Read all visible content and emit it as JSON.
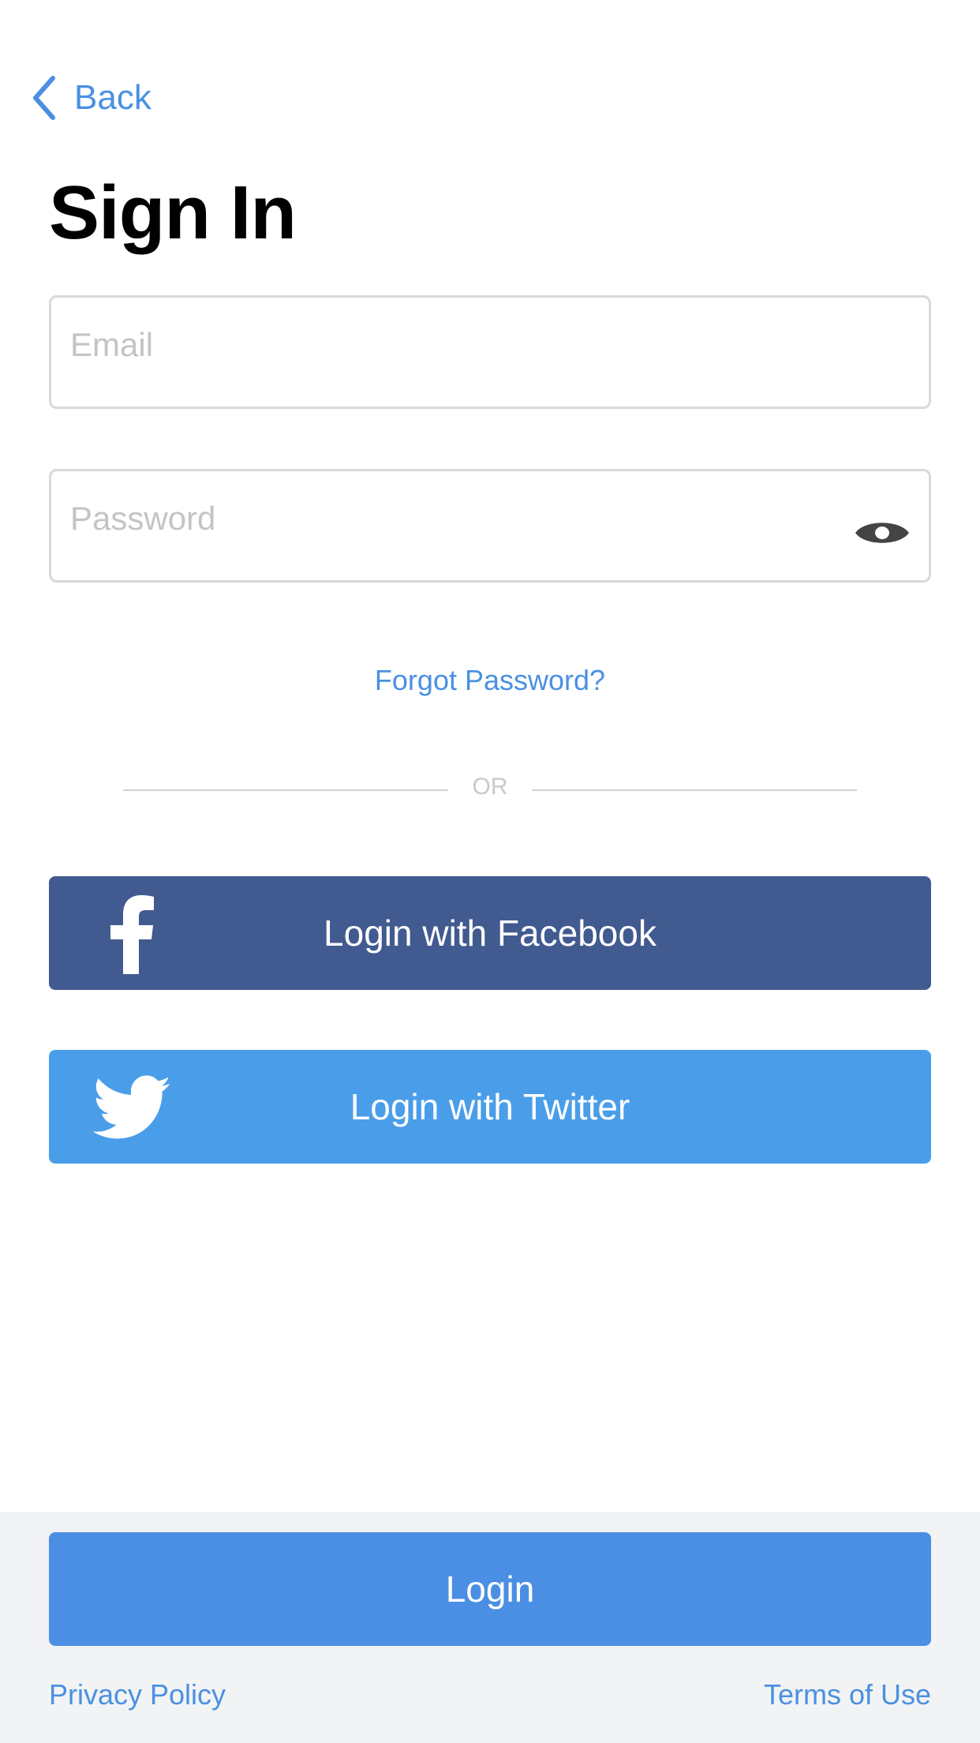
{
  "nav": {
    "back_label": "Back",
    "back_icon": "chevron-left-icon"
  },
  "title": "Sign In",
  "form": {
    "email_placeholder": "Email",
    "email_value": "",
    "password_placeholder": "Password",
    "password_value": "",
    "show_password_icon": "eye-icon",
    "forgot_label": "Forgot Password?"
  },
  "divider": {
    "label": "OR"
  },
  "social": {
    "facebook_label": "Login with Facebook",
    "facebook_icon": "facebook-icon",
    "twitter_label": "Login with Twitter",
    "twitter_icon": "twitter-icon"
  },
  "footer": {
    "login_label": "Login",
    "privacy_label": "Privacy Policy",
    "terms_label": "Terms of Use"
  },
  "colors": {
    "accent": "#4a90e2",
    "facebook": "#415a90",
    "twitter": "#4a9ee9",
    "login": "#4a8fe3",
    "footer_bg": "#f2f3f5"
  }
}
